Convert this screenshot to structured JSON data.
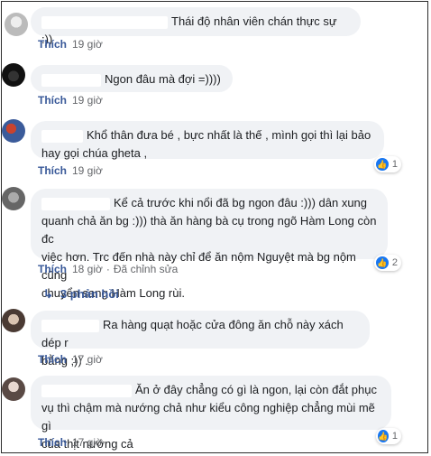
{
  "comments": [
    {
      "text": "Thái độ nhân viên chán thực sự :))",
      "like_label": "Thích",
      "time": "19 giờ"
    },
    {
      "text": "Ngon đâu mà đợi =))))",
      "like_label": "Thích",
      "time": "19 giờ"
    },
    {
      "line1": "Khổ thân đưa bé , bực nhất là thế , mình gọi thì lại bảo",
      "line2": "hay gọi chúa gheta ,",
      "like_label": "Thích",
      "time": "19 giờ",
      "reactions": "1"
    },
    {
      "line1": "Kể cả trước khi nổi đã bg ngon đâu :))) dân xung",
      "line2": "quanh chả ăn bg :))) thà ăn hàng bà cụ trong ngõ Hàm Long còn đc",
      "line3": "việc hơn. Trc đến nhà này chỉ để ăn nộm Nguyệt mà bg nộm cũng",
      "line4": "chuyển sang Hàm Long rùi.",
      "like_label": "Thích",
      "time": "18 giờ",
      "edited": "Đã chỉnh sửa",
      "reactions": "2",
      "replies": "3 phản hồi"
    },
    {
      "line1": "Ra hàng quạt hoặc cửa đông ăn chỗ này xách dép r",
      "line2": "bằng ;)) .",
      "like_label": "Thích",
      "time": "17 giờ"
    },
    {
      "line1": "Ăn ở đây chẳng có gì là ngon, lại còn đắt phục",
      "line2": "vụ thì chậm mà nướng chả như kiểu công nghiệp chẳng mùi mẽ gì",
      "line3": "của thịt nướng cả",
      "like_label": "Thích",
      "time": "17 giờ",
      "reactions": "1"
    }
  ],
  "colors": {
    "bubble": "#f0f2f5",
    "link": "#385898",
    "meta": "#65676b",
    "like_reaction": "#1877f2"
  },
  "icons": {
    "reaction": "thumbs-up-icon",
    "replies_arrow": "reply-arrow-icon"
  }
}
